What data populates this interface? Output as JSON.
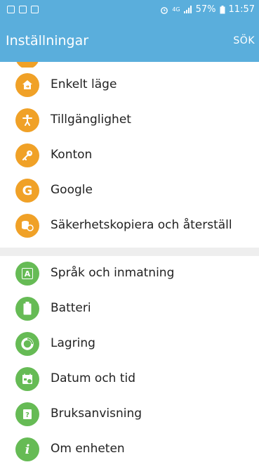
{
  "status_bar": {
    "network": "4G",
    "battery": "57%",
    "time": "11:57"
  },
  "header": {
    "title": "Inställningar",
    "search_label": "SÖK"
  },
  "sections": [
    {
      "color": "#f0a127",
      "items": [
        {
          "label": "Enkelt läge",
          "icon": "home-mode-icon"
        },
        {
          "label": "Tillgänglighet",
          "icon": "accessibility-icon"
        },
        {
          "label": "Konton",
          "icon": "key-icon"
        },
        {
          "label": "Google",
          "icon": "google-icon"
        },
        {
          "label": "Säkerhetskopiera och återställ",
          "icon": "backup-icon"
        }
      ]
    },
    {
      "color": "#66bb55",
      "items": [
        {
          "label": "Språk och inmatning",
          "icon": "language-icon"
        },
        {
          "label": "Batteri",
          "icon": "battery-icon"
        },
        {
          "label": "Lagring",
          "icon": "storage-icon"
        },
        {
          "label": "Datum och tid",
          "icon": "calendar-icon"
        },
        {
          "label": "Bruksanvisning",
          "icon": "manual-icon"
        },
        {
          "label": "Om enheten",
          "icon": "info-icon"
        }
      ]
    }
  ]
}
